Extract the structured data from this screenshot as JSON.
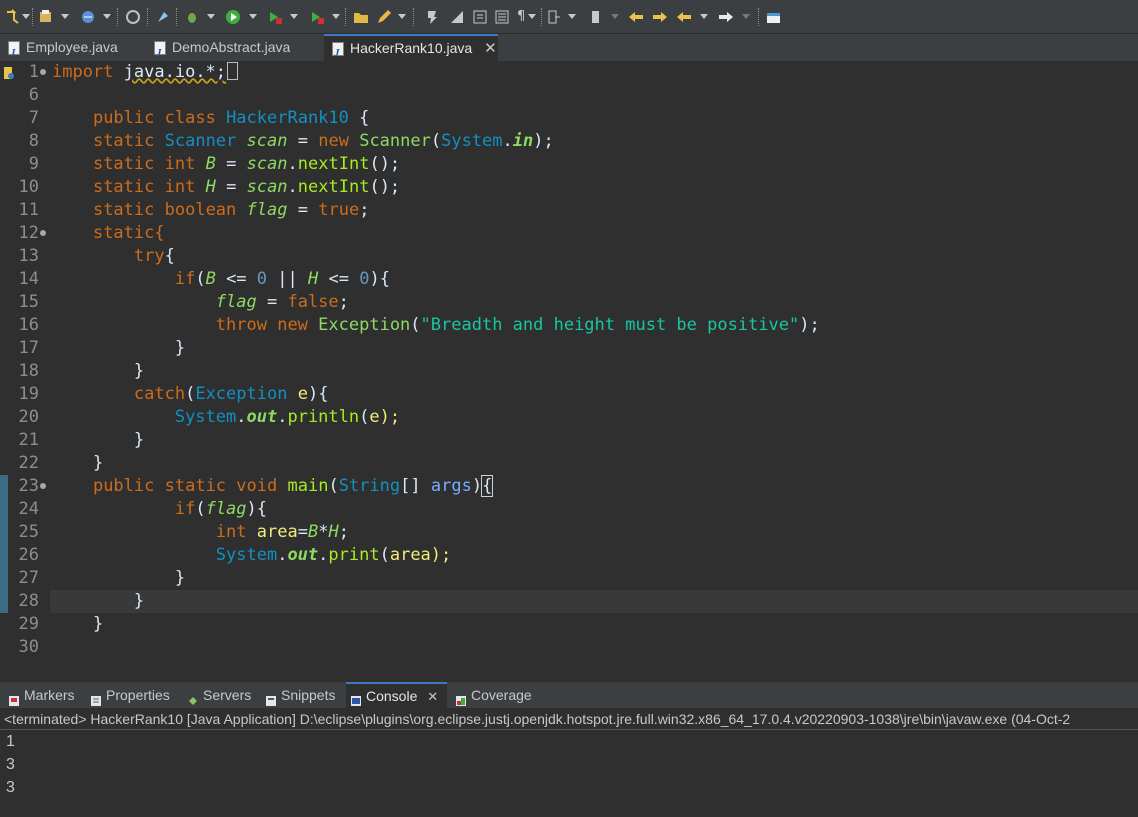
{
  "editor_tabs": [
    {
      "label": "Employee.java",
      "active": false
    },
    {
      "label": "DemoAbstract.java",
      "active": false
    },
    {
      "label": "HackerRank10.java",
      "active": true
    }
  ],
  "gutter": {
    "line_numbers": [
      "1",
      "6",
      "7",
      "8",
      "9",
      "10",
      "11",
      "12",
      "13",
      "14",
      "15",
      "16",
      "17",
      "18",
      "19",
      "20",
      "21",
      "22",
      "23",
      "24",
      "25",
      "26",
      "27",
      "28",
      "29",
      "30"
    ]
  },
  "code": {
    "l1_import": "import",
    "l1_pkg": "java.io.*;",
    "l7_public": "public",
    "l7_class": "class",
    "l7_name": "HackerRank10",
    "l7_brace": "{",
    "static": "static",
    "Scanner": "Scanner",
    "scan": "scan",
    "eq": "=",
    "new": "new",
    "System": "System",
    "dot": ".",
    "in": "in",
    "close_semi": ");",
    "int": "int",
    "B": "B",
    "H": "H",
    "nextInt": "nextInt",
    "parens_semi": "();",
    "boolean": "boolean",
    "flag": "flag",
    "true": "true",
    "semi": ";",
    "static_brace": "static{",
    "try": "try",
    "lbrace": "{",
    "if": "if",
    "lparen": "(",
    "le": "<=",
    "zero": "0",
    "or": "||",
    "rparen_brace": "){",
    "false": "false",
    "throw": "throw",
    "Exception": "Exception",
    "message": "\"Breadth and height must be positive\"",
    "rbrace": "}",
    "catch": "catch",
    "e": "e",
    "out": "out",
    "println": "println",
    "e_close": "e);",
    "void": "void",
    "main": "main",
    "String": "String",
    "brackets": "[]",
    "args": "args",
    "rparen": ")",
    "area": "area",
    "mul": "*",
    "print": "print",
    "area_close": "area);"
  },
  "bottom_tabs": [
    {
      "label": "Markers",
      "icon": "markers-icon"
    },
    {
      "label": "Properties",
      "icon": "properties-icon"
    },
    {
      "label": "Servers",
      "icon": "servers-icon"
    },
    {
      "label": "Snippets",
      "icon": "snippets-icon"
    },
    {
      "label": "Console",
      "icon": "console-icon",
      "active": true
    },
    {
      "label": "Coverage",
      "icon": "coverage-icon"
    }
  ],
  "console": {
    "status": "<terminated> HackerRank10 [Java Application] D:\\eclipse\\plugins\\org.eclipse.justj.openjdk.hotspot.jre.full.win32.x86_64_17.0.4.v20220903-1038\\jre\\bin\\javaw.exe  (04-Oct-2",
    "output": [
      "1",
      "3",
      "3"
    ]
  },
  "colors": {
    "keyword": "#cc6c1d",
    "type": "#1290c3",
    "string": "#17c6a3",
    "method": "#a7ec21",
    "field": "#8dda63",
    "background": "#2f2f2f"
  }
}
